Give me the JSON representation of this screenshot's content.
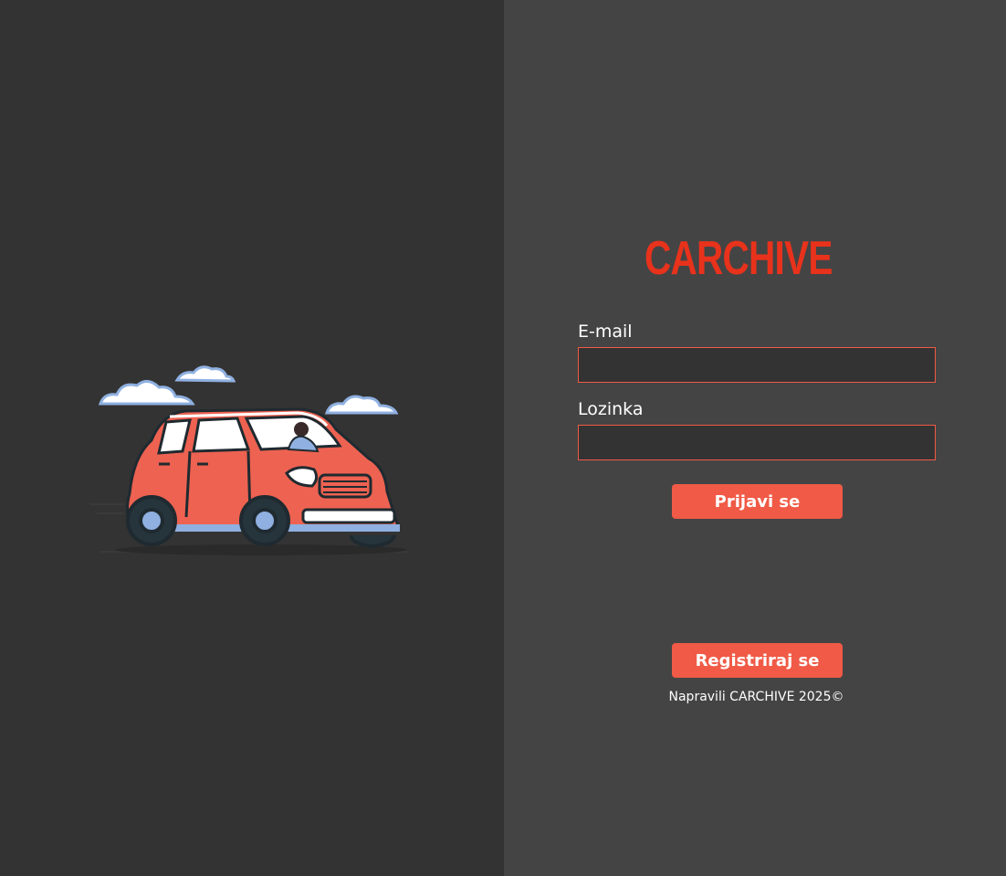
{
  "brand": {
    "name": "CARCHIVE",
    "accent_color": "#f05a46",
    "logo_color": "#e8321c"
  },
  "illustration": {
    "icon": "car-illustration"
  },
  "form": {
    "email_label": "E-mail",
    "email_value": "",
    "password_label": "Lozinka",
    "password_value": "",
    "login_button": "Prijavi se",
    "register_button": "Registriraj se"
  },
  "footer": {
    "text": "Napravili CARCHIVE 2025©"
  }
}
